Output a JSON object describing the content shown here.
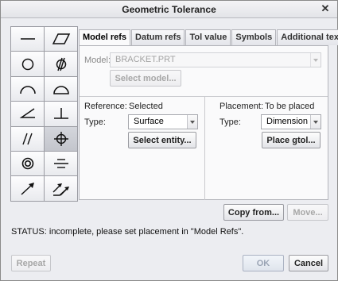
{
  "window": {
    "title": "Geometric Tolerance"
  },
  "symbols": [
    {
      "name": "straightness"
    },
    {
      "name": "flatness"
    },
    {
      "name": "circularity"
    },
    {
      "name": "cylindricity"
    },
    {
      "name": "profile-of-line"
    },
    {
      "name": "profile-of-surface"
    },
    {
      "name": "angularity"
    },
    {
      "name": "perpendicularity"
    },
    {
      "name": "parallelism"
    },
    {
      "name": "position",
      "selected": true
    },
    {
      "name": "concentricity"
    },
    {
      "name": "symmetry"
    },
    {
      "name": "circular-runout"
    },
    {
      "name": "total-runout"
    }
  ],
  "tabs": [
    "Model refs",
    "Datum refs",
    "Tol value",
    "Symbols",
    "Additional text"
  ],
  "model": {
    "label": "Model:",
    "value": "BRACKET.PRT",
    "select_button": "Select model..."
  },
  "reference": {
    "label": "Reference:",
    "value": "Selected",
    "type_label": "Type:",
    "type_value": "Surface",
    "select_button": "Select entity..."
  },
  "placement": {
    "label": "Placement:",
    "value": "To be placed",
    "type_label": "Type:",
    "type_value": "Dimension",
    "place_button": "Place gtol..."
  },
  "actions": {
    "copy_from": "Copy from...",
    "move": "Move..."
  },
  "status": "STATUS: incomplete, please set placement in \"Model Refs\".",
  "footer": {
    "repeat": "Repeat",
    "ok": "OK",
    "cancel": "Cancel"
  }
}
